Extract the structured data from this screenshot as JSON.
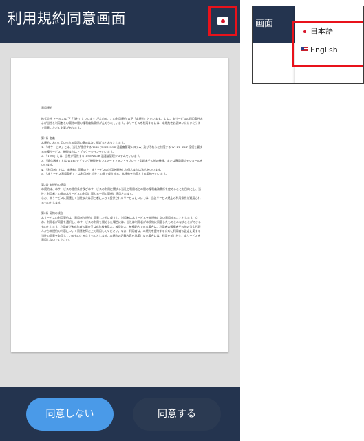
{
  "phone": {
    "title": "利用規約同意画面",
    "flag_button_icon": "japan-flag-icon",
    "buttons": {
      "disagree": "同意しない",
      "agree": "同意する"
    },
    "colors": {
      "header_bg": "#24344f",
      "disagree_bg": "#4a9ae8",
      "agree_bg": "#2b3a52",
      "highlight": "#e8121b"
    }
  },
  "terms": {
    "heading": "利用規約",
    "paragraphs": [
      "株式会社 アーキス(以下「当社」といいます)が定める、この利用規約(以下「本規約」といいます。)には、本サービスの利用条件および当社と利用者との関係の間の権利義務関係が定められています。本サービスを利用するには、本規約をお読みいただいたうえで同意いただく必要があります。",
      "第1条 定義",
      "本規約において用いられる用語の意味は次に掲げるとおりとします。",
      "1. 「本サービス」とは、当社が提供する TMS (T-SENSOR 温湿度管理システム) 及びそれらに付随する WI-FI・BLT 接続を要する各種サービス、機能またはアプリケーションをいいます。",
      "2. 「TMS」とは、当社が提供する T-SENSOR 温湿度管理システムをいいます。",
      "3. 「通信端末」とは WI-FI テザリング機能をもつスマートフォン・タブレット型端末その他の機器、または専用通信モジュールをいいます。",
      "4. 「利用者」とは、本規約に同意の上、本サービスの利用を開始した個人または法人をいいます。",
      "5. 「本サービス利用契約」とは利用者と当社との間で成立する、本規約を内容とする契約をいいます。",
      "第2条 本規約の適用",
      "本規約は、本サービスの提供条件及び本サービスの利用に関する当社と利用者との間の権利義務関係を定めることを目的とし、当社と利用者との間の本サービスの利用に関わる一切の関係に適用されます。",
      "なお、本サービスに関連して当社または第三者によって提供されるサービスについては、当該サービス規定の利用条件が適用されるものとします。",
      "第3条 契約の成立",
      "本サービスの利用契約は、利用者が規約に同意した時に成立し、利用者は本サービスを本規約に従い利用することとします。なお、利用者が同意を選択し、本サービスの利用を開始した場合には、当社は利用者が本規約に同意したものとみなすことができるものとします。利用者が未成年者の場合又は成年被後見人、被保佐人、被補助人である場合は、利用者の親権者その他の法定代理人から本規約の内容について同意を得た上で利用してください。なお、利用者は、本規約を遵守するために利用者の設定に関する当社の同意を取得しているものとみなすものとします。本規約の記載内容を承諾しない場合には、利用を差し控え、本サービスを利用しないでください。"
    ]
  },
  "language_menu": {
    "header_title": "画面",
    "options": [
      {
        "label": "日本語",
        "icon": "japan-flag-icon",
        "selected": true
      },
      {
        "label": "English",
        "icon": "us-flag-icon",
        "selected": false
      }
    ]
  }
}
